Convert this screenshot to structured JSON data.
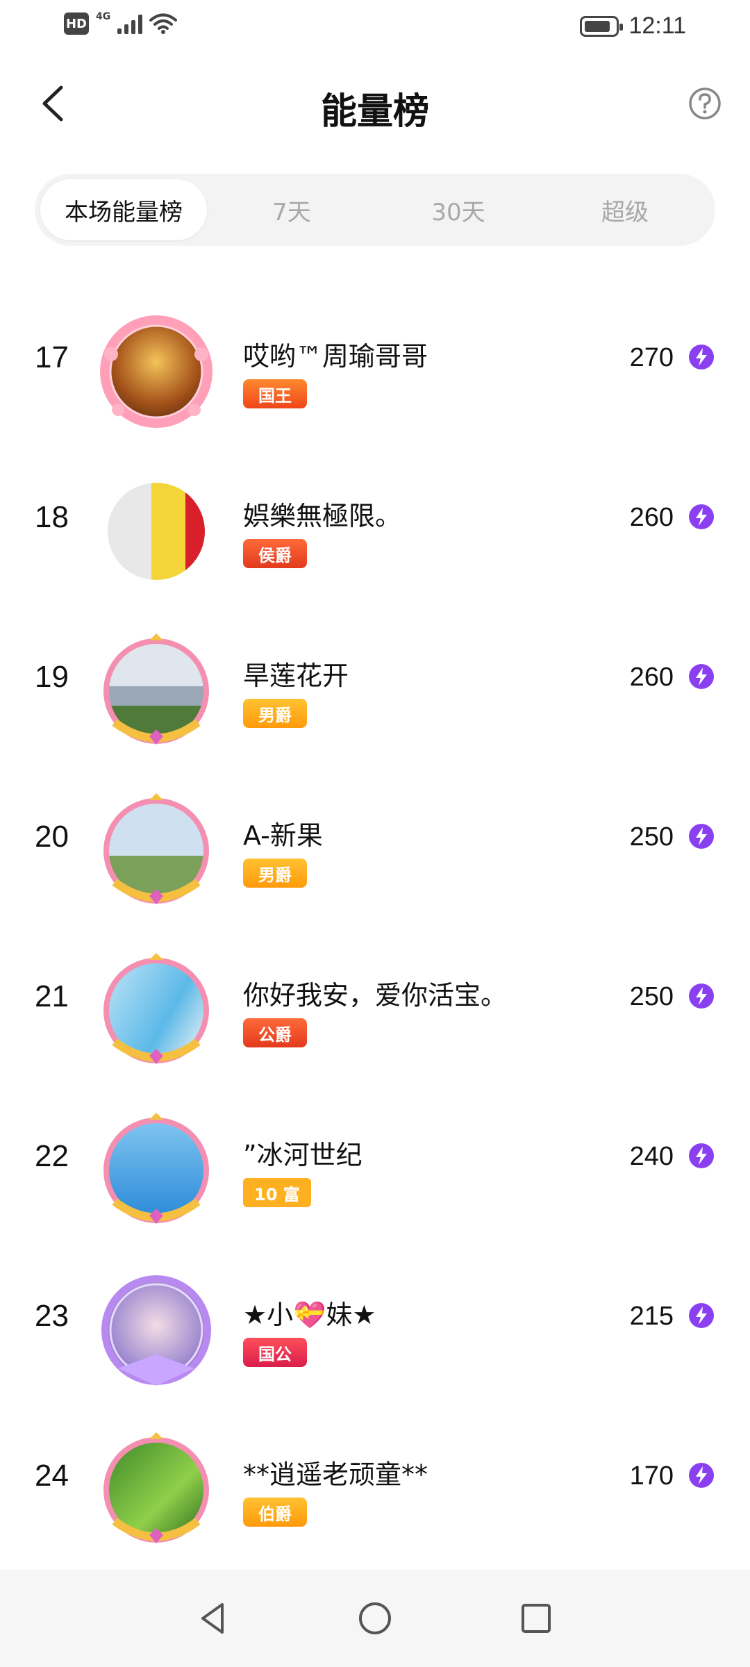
{
  "status_bar": {
    "hd": "HD",
    "network": "4G",
    "time": "12:11"
  },
  "header": {
    "title": "能量榜"
  },
  "tabs": [
    {
      "label": "本场能量榜",
      "active": true
    },
    {
      "label": "7天",
      "active": false
    },
    {
      "label": "30天",
      "active": false
    },
    {
      "label": "超级",
      "active": false
    }
  ],
  "ranking": [
    {
      "rank": "17",
      "name": "哎哟™周瑜哥哥",
      "badge": "国王",
      "score": "270"
    },
    {
      "rank": "18",
      "name": "娯樂無極限。",
      "badge": "侯爵",
      "score": "260"
    },
    {
      "rank": "19",
      "name": "旱莲花开",
      "badge": "男爵",
      "score": "260"
    },
    {
      "rank": "20",
      "name": "A-新果",
      "badge": "男爵",
      "score": "250"
    },
    {
      "rank": "21",
      "name": "你好我安，爱你活宝。",
      "badge": "公爵",
      "score": "250"
    },
    {
      "rank": "22",
      "name": "”冰河世纪",
      "badge": "10 富",
      "score": "240"
    },
    {
      "rank": "23",
      "name": "★小💝妹★",
      "badge": "国公",
      "score": "215"
    },
    {
      "rank": "24",
      "name": "**逍遥老顽童**",
      "badge": "伯爵",
      "score": "170"
    }
  ],
  "colors": {
    "accent_purple": "#8a3ff0",
    "badge_orange": "#ff9a0a",
    "tab_bg": "#f3f3f3"
  }
}
